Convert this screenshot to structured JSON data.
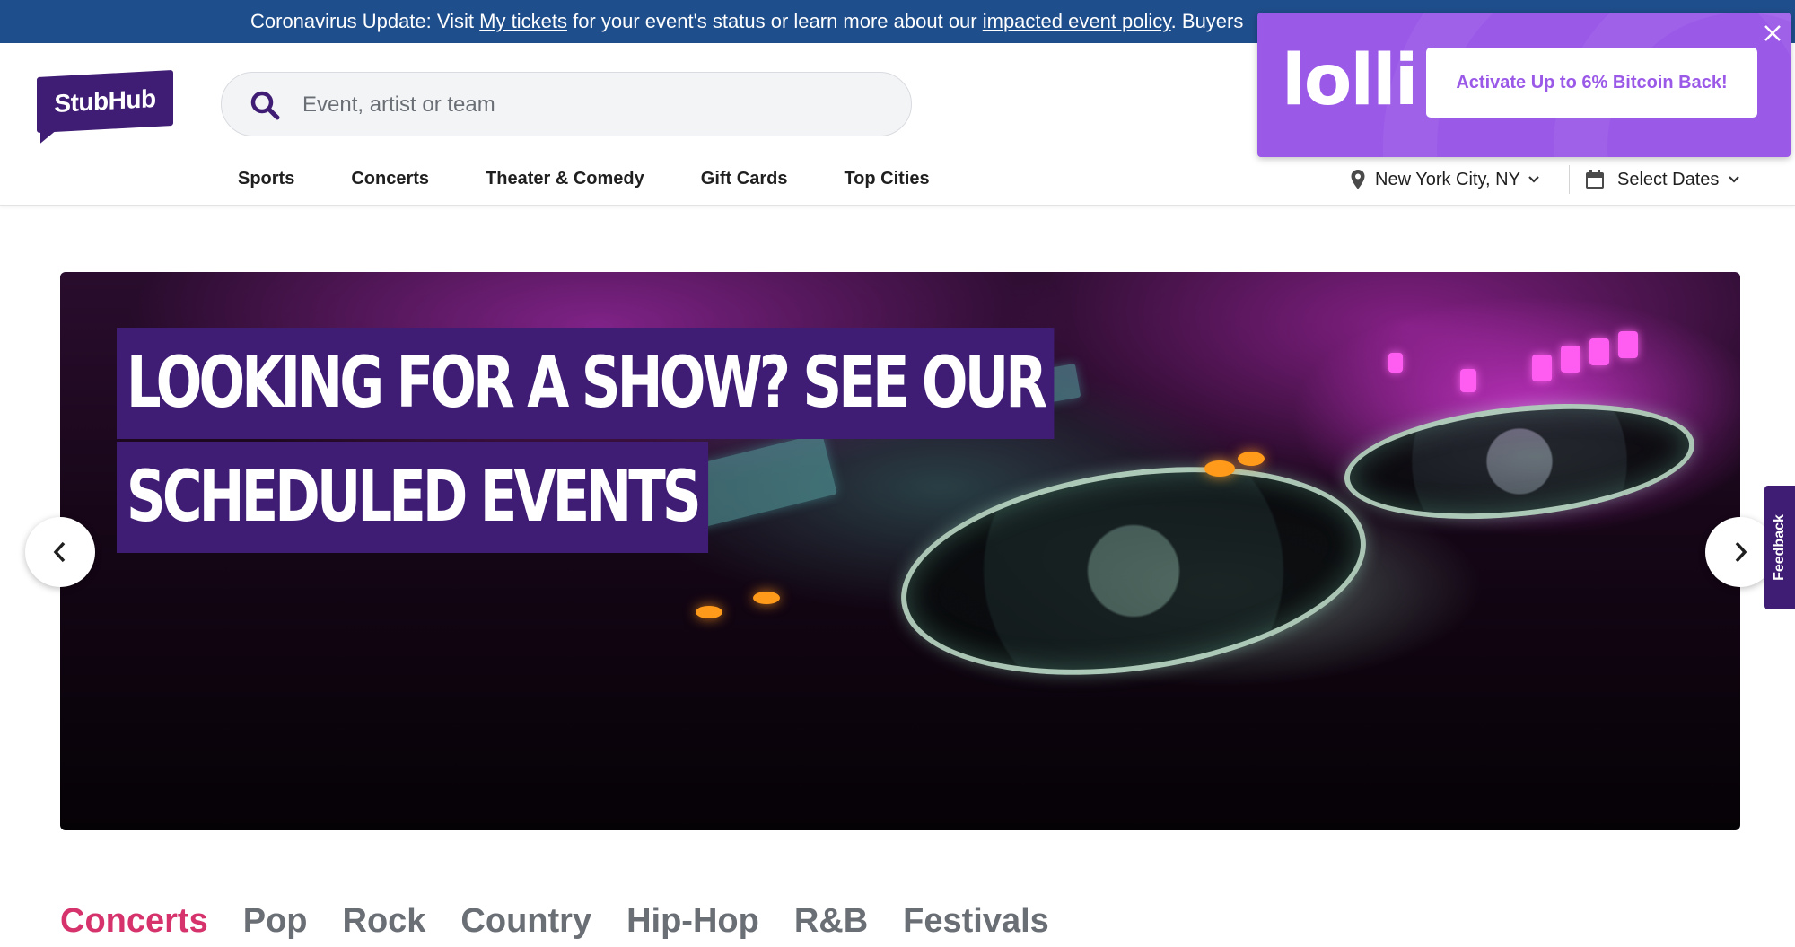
{
  "banner": {
    "prefix": "Coronavirus Update: Visit ",
    "link1": "My tickets",
    "middle": " for your event's status or learn more about our ",
    "link2": "impacted event policy",
    "suffix": ". Buyers"
  },
  "header": {
    "logo": "StubHub",
    "search_placeholder": "Event, artist or team",
    "nav": [
      "Sports",
      "Concerts",
      "Theater & Comedy",
      "Gift Cards",
      "Top Cities"
    ],
    "location": "New York City, NY",
    "dates": "Select Dates"
  },
  "lolli": {
    "brand": "lolli",
    "cta": "Activate Up to 6% Bitcoin Back!"
  },
  "hero": {
    "line1": "LOOKING FOR A SHOW? SEE OUR",
    "line2": "SCHEDULED EVENTS"
  },
  "feedback": "Feedback",
  "categories": [
    "Concerts",
    "Pop",
    "Rock",
    "Country",
    "Hip-Hop",
    "R&B",
    "Festivals"
  ],
  "colors": {
    "banner": "#1f4e8c",
    "brand_purple": "#3f1d74",
    "lolli_purple": "#9b59e8",
    "active_category": "#d6336c",
    "inactive_category": "#6a6e75"
  },
  "icons": {
    "search": "search-icon",
    "location": "location-pin-icon",
    "calendar": "calendar-icon",
    "chevron": "chevron-down-icon",
    "close": "close-icon",
    "prev": "chevron-left-icon",
    "next": "chevron-right-icon"
  }
}
